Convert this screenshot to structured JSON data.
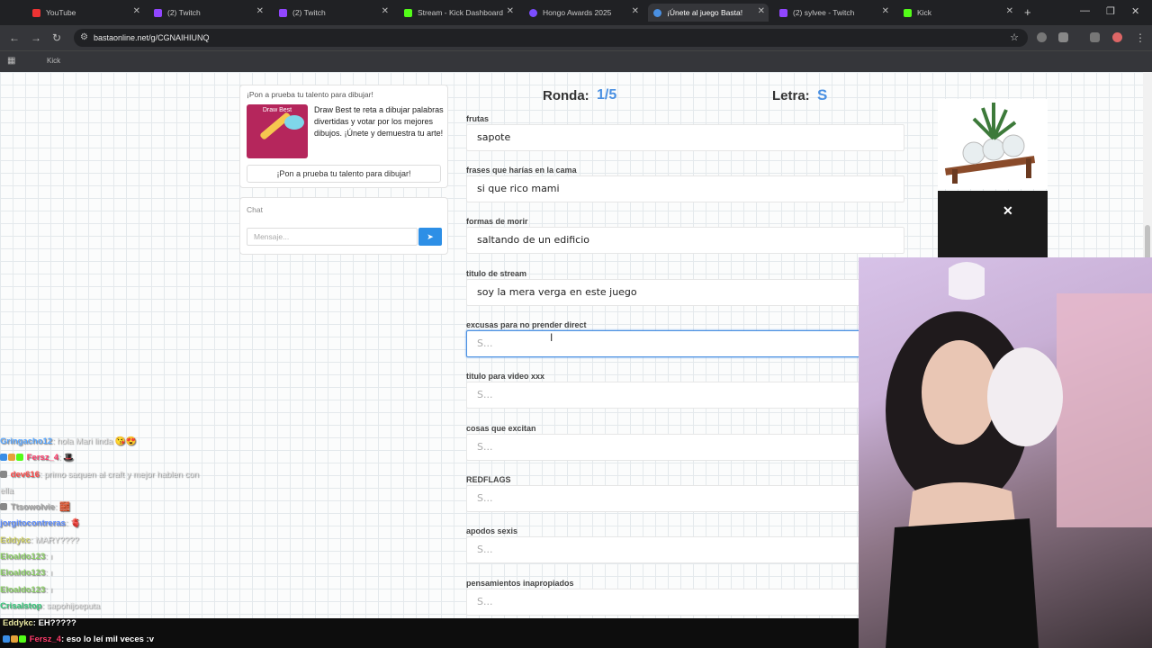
{
  "browser": {
    "tabs": [
      {
        "title": "YouTube",
        "color": "#e33",
        "active": false
      },
      {
        "title": "(2) Twitch",
        "color": "#9146ff",
        "active": false
      },
      {
        "title": "(2) Twitch",
        "color": "#9146ff",
        "active": false
      },
      {
        "title": "Stream - Kick Dashboard",
        "color": "#53fc18",
        "active": false
      },
      {
        "title": "Hongo Awards 2025",
        "color": "#7b4dff",
        "active": false
      },
      {
        "title": "¡Únete al juego Basta!",
        "color": "#4a90e2",
        "active": true
      },
      {
        "title": "(2) sylvee - Twitch",
        "color": "#9146ff",
        "active": false
      },
      {
        "title": "Kick",
        "color": "#53fc18",
        "active": false
      }
    ],
    "url": "bastaonline.net/g/CGNAIHIUNQ",
    "bookmark": "Kick"
  },
  "promo": {
    "heading": "¡Pon a prueba tu talento para dibujar!",
    "image_label": "Draw Best",
    "text": "Draw Best te reta a dibujar palabras divertidas y votar por los mejores dibujos. ¡Únete y demuestra tu arte!",
    "button": "¡Pon a prueba tu talento para dibujar!"
  },
  "chat": {
    "title": "Chat",
    "placeholder": "Mensaje..."
  },
  "game": {
    "round_label": "Ronda:",
    "round_value": "1/5",
    "letter_label": "Letra:",
    "letter_value": "S",
    "categories": [
      {
        "label": "frutas",
        "value": "sapote"
      },
      {
        "label": "frases que harías en la cama",
        "value": "si que rico mami"
      },
      {
        "label": "formas de morir",
        "value": "saltando de un edificio"
      },
      {
        "label": "titulo de stream",
        "value": "soy la mera verga en este juego"
      },
      {
        "label": "excusas para no prender direct",
        "value": "S..."
      },
      {
        "label": "titulo para video xxx",
        "value": "S..."
      },
      {
        "label": "cosas que excitan",
        "value": "S..."
      },
      {
        "label": "REDFLAGS",
        "value": "S..."
      },
      {
        "label": "apodos sexis",
        "value": "S..."
      },
      {
        "label": "pensamientos inapropiados",
        "value": "S..."
      }
    ]
  },
  "stream_chat": [
    {
      "user": "Gringacho12",
      "color": "#5ba8ff",
      "text": ": hola Mari linda 😘😍"
    },
    {
      "user": "Fersz_4",
      "color": "#ff3b6b",
      "text": ": 🎩"
    },
    {
      "user": "dev616",
      "color": "#ff4a4a",
      "text": ": primo saquen al craft y mejor hablen con"
    },
    {
      "user": "",
      "color": "#e6e6e6",
      "text": "ella"
    },
    {
      "user": "Ttsowolvie",
      "color": "#aaaaaa",
      "text": ": 🧱"
    },
    {
      "user": "jorgitocontreras",
      "color": "#5b8cff",
      "text": ": 🫀"
    },
    {
      "user": "Eddykc",
      "color": "#d4d66a",
      "text": ": MARY????"
    },
    {
      "user": "Eloaldo123",
      "color": "#8fd16a",
      "text": ": ı"
    },
    {
      "user": "Eloaldo123",
      "color": "#8fd16a",
      "text": ": ı"
    },
    {
      "user": "Eloaldo123",
      "color": "#8fd16a",
      "text": ": ı"
    },
    {
      "user": "Crisalstop",
      "color": "#34c97a",
      "text": ": sapohijoeputa"
    }
  ],
  "bottom_chat": [
    {
      "user": "Eddykc",
      "color": "#e8e6a0",
      "text": ": EH?????"
    },
    {
      "user": "Fersz_4",
      "color": "#ff3b6b",
      "text": ": eso lo leí mil veces :v"
    }
  ]
}
